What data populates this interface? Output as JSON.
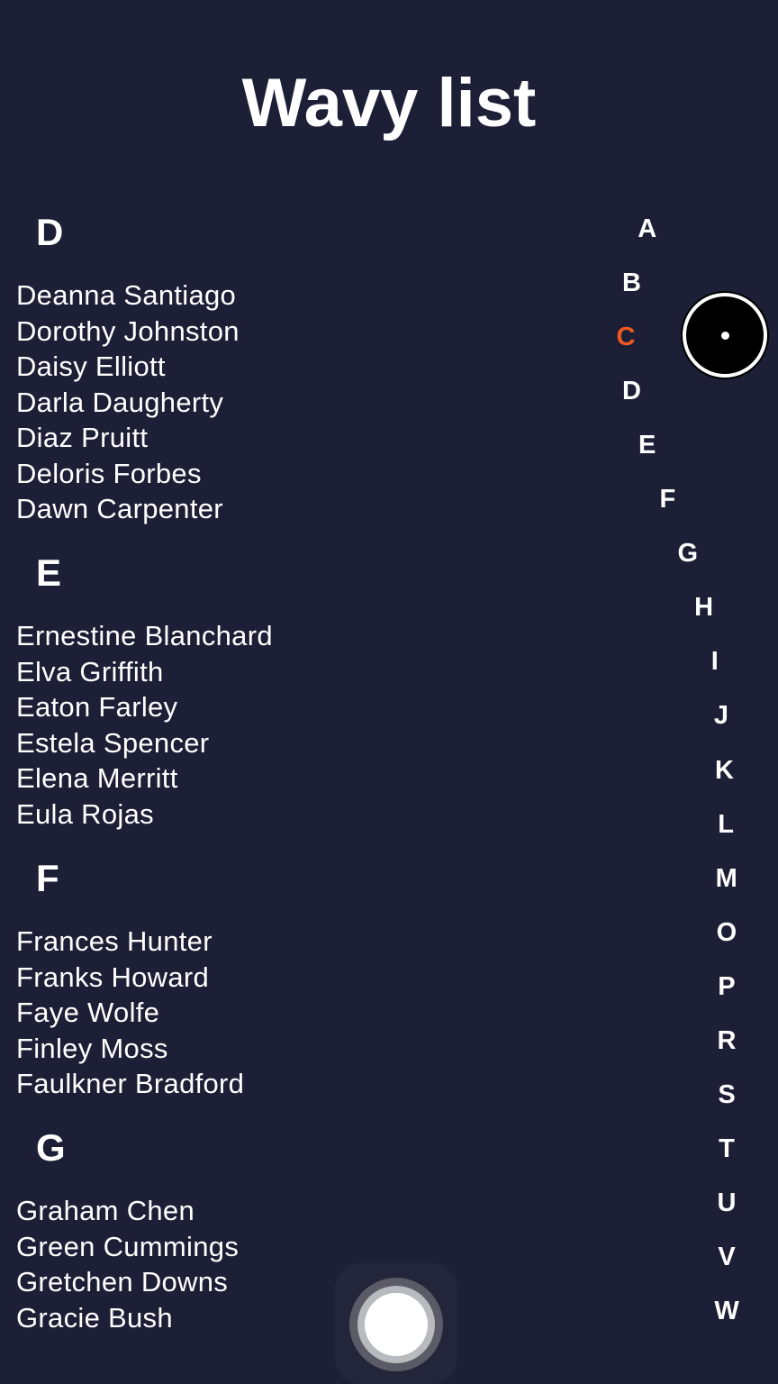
{
  "title": "Wavy list",
  "sections": [
    {
      "letter": "D",
      "names": [
        "Deanna Santiago",
        "Dorothy Johnston",
        "Daisy Elliott",
        "Darla Daugherty",
        "Diaz Pruitt",
        "Deloris Forbes",
        "Dawn Carpenter"
      ]
    },
    {
      "letter": "E",
      "names": [
        "Ernestine Blanchard",
        "Elva Griffith",
        "Eaton Farley",
        "Estela Spencer",
        "Elena Merritt",
        "Eula Rojas"
      ]
    },
    {
      "letter": "F",
      "names": [
        "Frances Hunter",
        "Franks Howard",
        "Faye Wolfe",
        "Finley Moss",
        "Faulkner Bradford"
      ]
    },
    {
      "letter": "G",
      "names": [
        "Graham Chen",
        "Green Cummings",
        "Gretchen Downs",
        "Gracie Bush"
      ]
    }
  ],
  "index": {
    "letters": [
      "A",
      "B",
      "C",
      "D",
      "E",
      "F",
      "G",
      "H",
      "I",
      "J",
      "K",
      "L",
      "M",
      "O",
      "P",
      "R",
      "S",
      "T",
      "U",
      "V",
      "W"
    ],
    "active": "C",
    "active_color": "#ef5a22"
  },
  "colors": {
    "background": "#1c1f35",
    "text": "#ffffff"
  },
  "icons": {
    "touch_indicator": "touch-point-icon",
    "assistive_touch": "assistive-touch-icon"
  }
}
